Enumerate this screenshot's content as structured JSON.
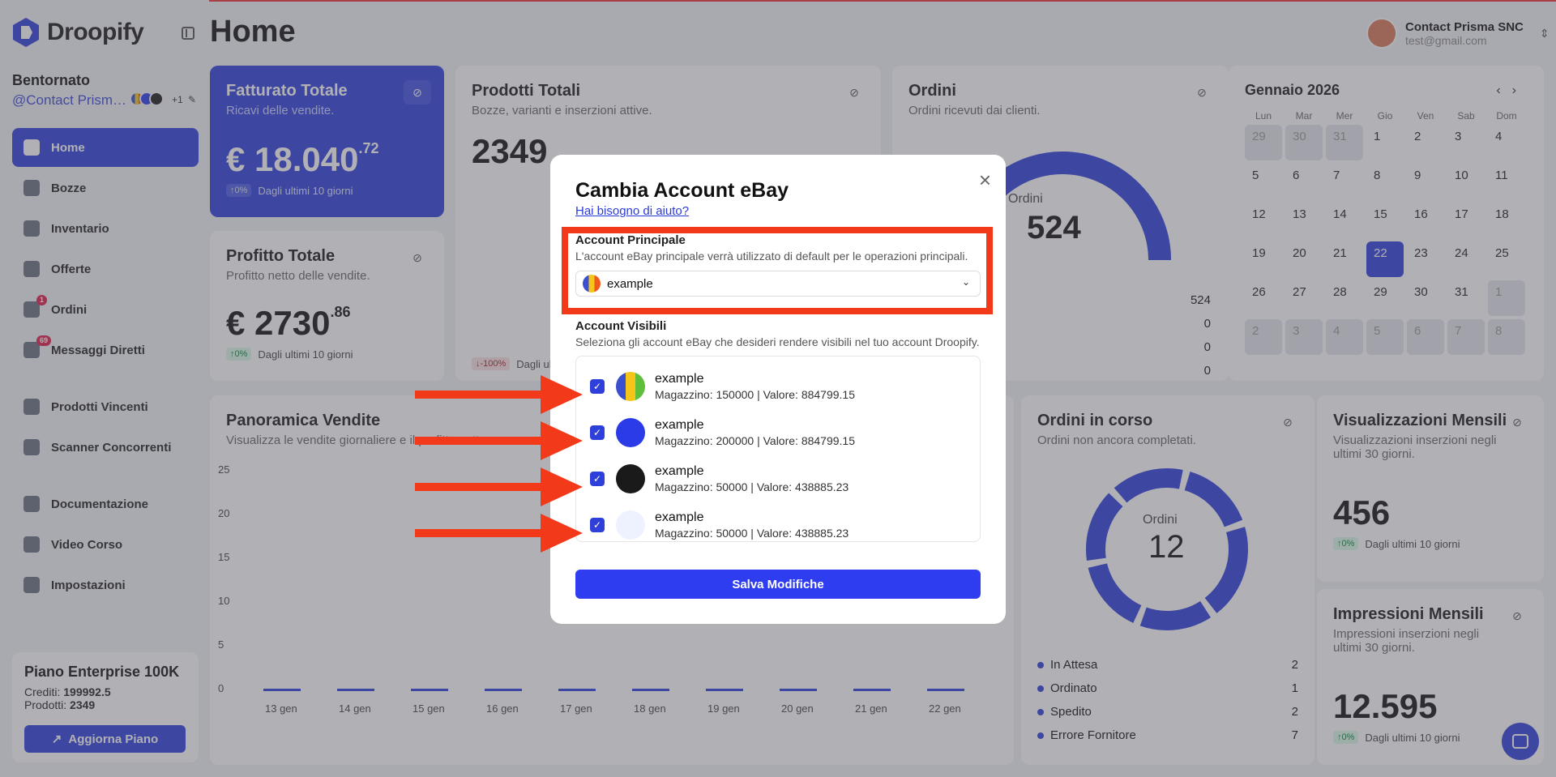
{
  "brand": {
    "name": "Droopify",
    "accent": "#2f3fd9"
  },
  "header": {
    "title": "Home",
    "account_name": "Contact Prisma SNC",
    "account_email": "test@gmail.com"
  },
  "sidebar": {
    "greeting": "Bentornato",
    "handle": "@Contact Prisma SNC",
    "extra_accounts": "+1",
    "items": [
      {
        "label": "Home",
        "icon": "home-icon"
      },
      {
        "label": "Bozze",
        "icon": "drafts-icon"
      },
      {
        "label": "Inventario",
        "icon": "inventory-icon"
      },
      {
        "label": "Offerte",
        "icon": "offers-icon"
      },
      {
        "label": "Ordini",
        "icon": "cart-icon",
        "badge": "1"
      },
      {
        "label": "Messaggi Diretti",
        "icon": "messages-icon",
        "badge": "69"
      },
      {
        "label": "Prodotti Vincenti",
        "icon": "rocket-icon"
      },
      {
        "label": "Scanner Concorrenti",
        "icon": "scanner-icon"
      },
      {
        "label": "Documentazione",
        "icon": "docs-icon"
      },
      {
        "label": "Video Corso",
        "icon": "video-icon"
      },
      {
        "label": "Impostazioni",
        "icon": "settings-icon"
      }
    ],
    "plan": {
      "title": "Piano Enterprise 100K",
      "credits_label": "Crediti:",
      "credits": "199992.5",
      "products_label": "Prodotti:",
      "products": "2349",
      "upgrade": "Aggiorna Piano"
    }
  },
  "cards": {
    "revenue": {
      "title": "Fatturato Totale",
      "sub": "Ricavi delle vendite.",
      "value": "€ 18.040",
      "cents": ".72",
      "pill": "↑0%",
      "period": "Dagli ultimi 10 giorni"
    },
    "products": {
      "title": "Prodotti Totali",
      "sub": "Bozze, varianti e inserzioni attive.",
      "value": "2349",
      "pill": "↓-100%",
      "period": "Dagli ultimi 10 giorni"
    },
    "orders": {
      "title": "Ordini",
      "sub": "Ordini ricevuti dai clienti.",
      "gauge_label": "Ordini",
      "gauge_value": "524",
      "rows": [
        "524",
        "0",
        "0",
        "0"
      ]
    },
    "profit": {
      "title": "Profitto Totale",
      "sub": "Profitto netto delle vendite.",
      "value": "€ 2730",
      "cents": ".86",
      "pill": "↑0%",
      "period": "Dagli ultimi 10 giorni"
    },
    "calendar": {
      "month": "Gennaio 2026",
      "dow": [
        "Lun",
        "Mar",
        "Mer",
        "Gio",
        "Ven",
        "Sab",
        "Dom"
      ],
      "days": [
        "29",
        "30",
        "31",
        "1",
        "2",
        "3",
        "4",
        "5",
        "6",
        "7",
        "8",
        "9",
        "10",
        "11",
        "12",
        "13",
        "14",
        "15",
        "16",
        "17",
        "18",
        "19",
        "20",
        "21",
        "22",
        "23",
        "24",
        "25",
        "26",
        "27",
        "28",
        "29",
        "30",
        "31",
        "1",
        "2",
        "3",
        "4",
        "5",
        "6",
        "7",
        "8"
      ],
      "today": "22"
    },
    "sales": {
      "title": "Panoramica Vendite",
      "sub": "Visualizza le vendite giornaliere e il profitto netto."
    },
    "open_orders": {
      "title": "Ordini in corso",
      "sub": "Ordini non ancora completati.",
      "donut_label": "Ordini",
      "donut_value": "12",
      "legend": [
        {
          "label": "In Attesa",
          "value": "2"
        },
        {
          "label": "Ordinato",
          "value": "1"
        },
        {
          "label": "Spedito",
          "value": "2"
        },
        {
          "label": "Errore Fornitore",
          "value": "7"
        }
      ]
    },
    "views": {
      "title": "Visualizzazioni Mensili",
      "sub": "Visualizzazioni inserzioni negli ultimi 30 giorni.",
      "value": "456",
      "pill": "↑0%",
      "period": "Dagli ultimi 10 giorni"
    },
    "impressions": {
      "title": "Impressioni Mensili",
      "sub": "Impressioni inserzioni negli ultimi 30 giorni.",
      "value": "12.595",
      "pill": "↑0%",
      "period": "Dagli ultimi 10 giorni"
    }
  },
  "chart_data": {
    "type": "bar",
    "categories": [
      "13 gen",
      "14 gen",
      "15 gen",
      "16 gen",
      "17 gen",
      "18 gen",
      "19 gen",
      "20 gen",
      "21 gen",
      "22 gen"
    ],
    "values": [
      0,
      0,
      0,
      0,
      0,
      0,
      0,
      0,
      0,
      0
    ],
    "yticks": [
      "25",
      "20",
      "15",
      "10",
      "5",
      "0"
    ],
    "ylim": [
      0,
      25
    ],
    "title": "Panoramica Vendite",
    "xlabel": "",
    "ylabel": ""
  },
  "modal": {
    "title": "Cambia Account eBay",
    "help": "Hai bisogno di aiuto?",
    "primary_title": "Account Principale",
    "primary_desc": "L'account eBay principale verrà utilizzato di default per le operazioni principali.",
    "primary_selected": "example",
    "visible_title": "Account Visibili",
    "visible_desc": "Seleziona gli account eBay che desideri rendere visibili nel tuo account Droopify.",
    "accounts": [
      {
        "name": "example",
        "meta": "Magazzino: 150000 | Valore: 884799.15"
      },
      {
        "name": "example",
        "meta": "Magazzino: 200000 | Valore: 884799.15"
      },
      {
        "name": "example",
        "meta": "Magazzino: 50000 | Valore: 438885.23"
      },
      {
        "name": "example",
        "meta": "Magazzino: 50000 | Valore: 438885.23"
      }
    ],
    "save": "Salva Modifiche",
    "annotation_color": "#f23a1a"
  }
}
